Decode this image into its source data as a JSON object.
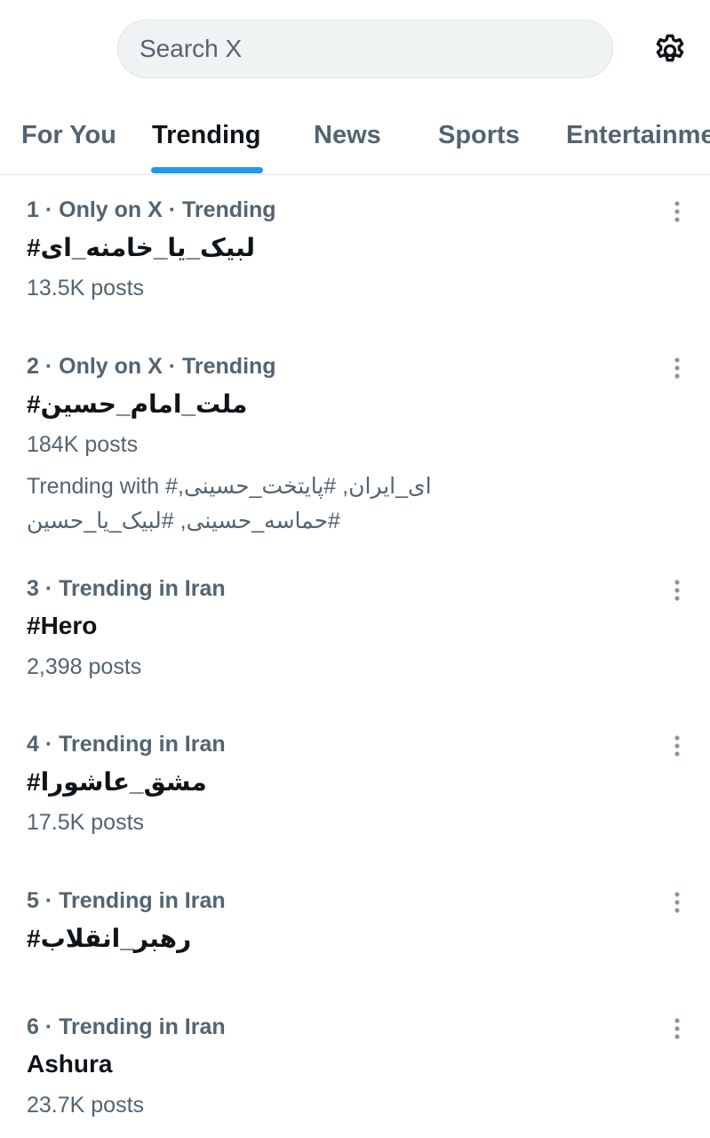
{
  "search": {
    "placeholder": "Search X"
  },
  "tabs": [
    {
      "label": "For You"
    },
    {
      "label": "Trending"
    },
    {
      "label": "News"
    },
    {
      "label": "Sports"
    },
    {
      "label": "Entertainment"
    }
  ],
  "active_tab": "Trending",
  "accent_color": "#1d9bf0",
  "trends": [
    {
      "meta": "1 · Only on X · Trending",
      "name": "#لبیک_یا_خامنه_ای",
      "posts": "13.5K posts"
    },
    {
      "meta": "2 · Only on X · Trending",
      "name": "#ملت_امام_حسین",
      "posts": "184K posts",
      "trending_with": "Trending with #ای_ایران, #پایتخت_حسینی, #حماسه_حسینی, #لبیک_یا_حسین"
    },
    {
      "meta": "3 · Trending in Iran",
      "name": "#Hero",
      "posts": "2,398 posts"
    },
    {
      "meta": "4 · Trending in Iran",
      "name": "#مشق_عاشورا",
      "posts": "17.5K posts"
    },
    {
      "meta": "5 · Trending in Iran",
      "name": "#رهبر_انقلاب"
    },
    {
      "meta": "6 · Trending in Iran",
      "name": "Ashura",
      "posts": "23.7K posts"
    }
  ],
  "icons": {
    "settings": "gear-icon",
    "more": "more-vertical-icon"
  }
}
